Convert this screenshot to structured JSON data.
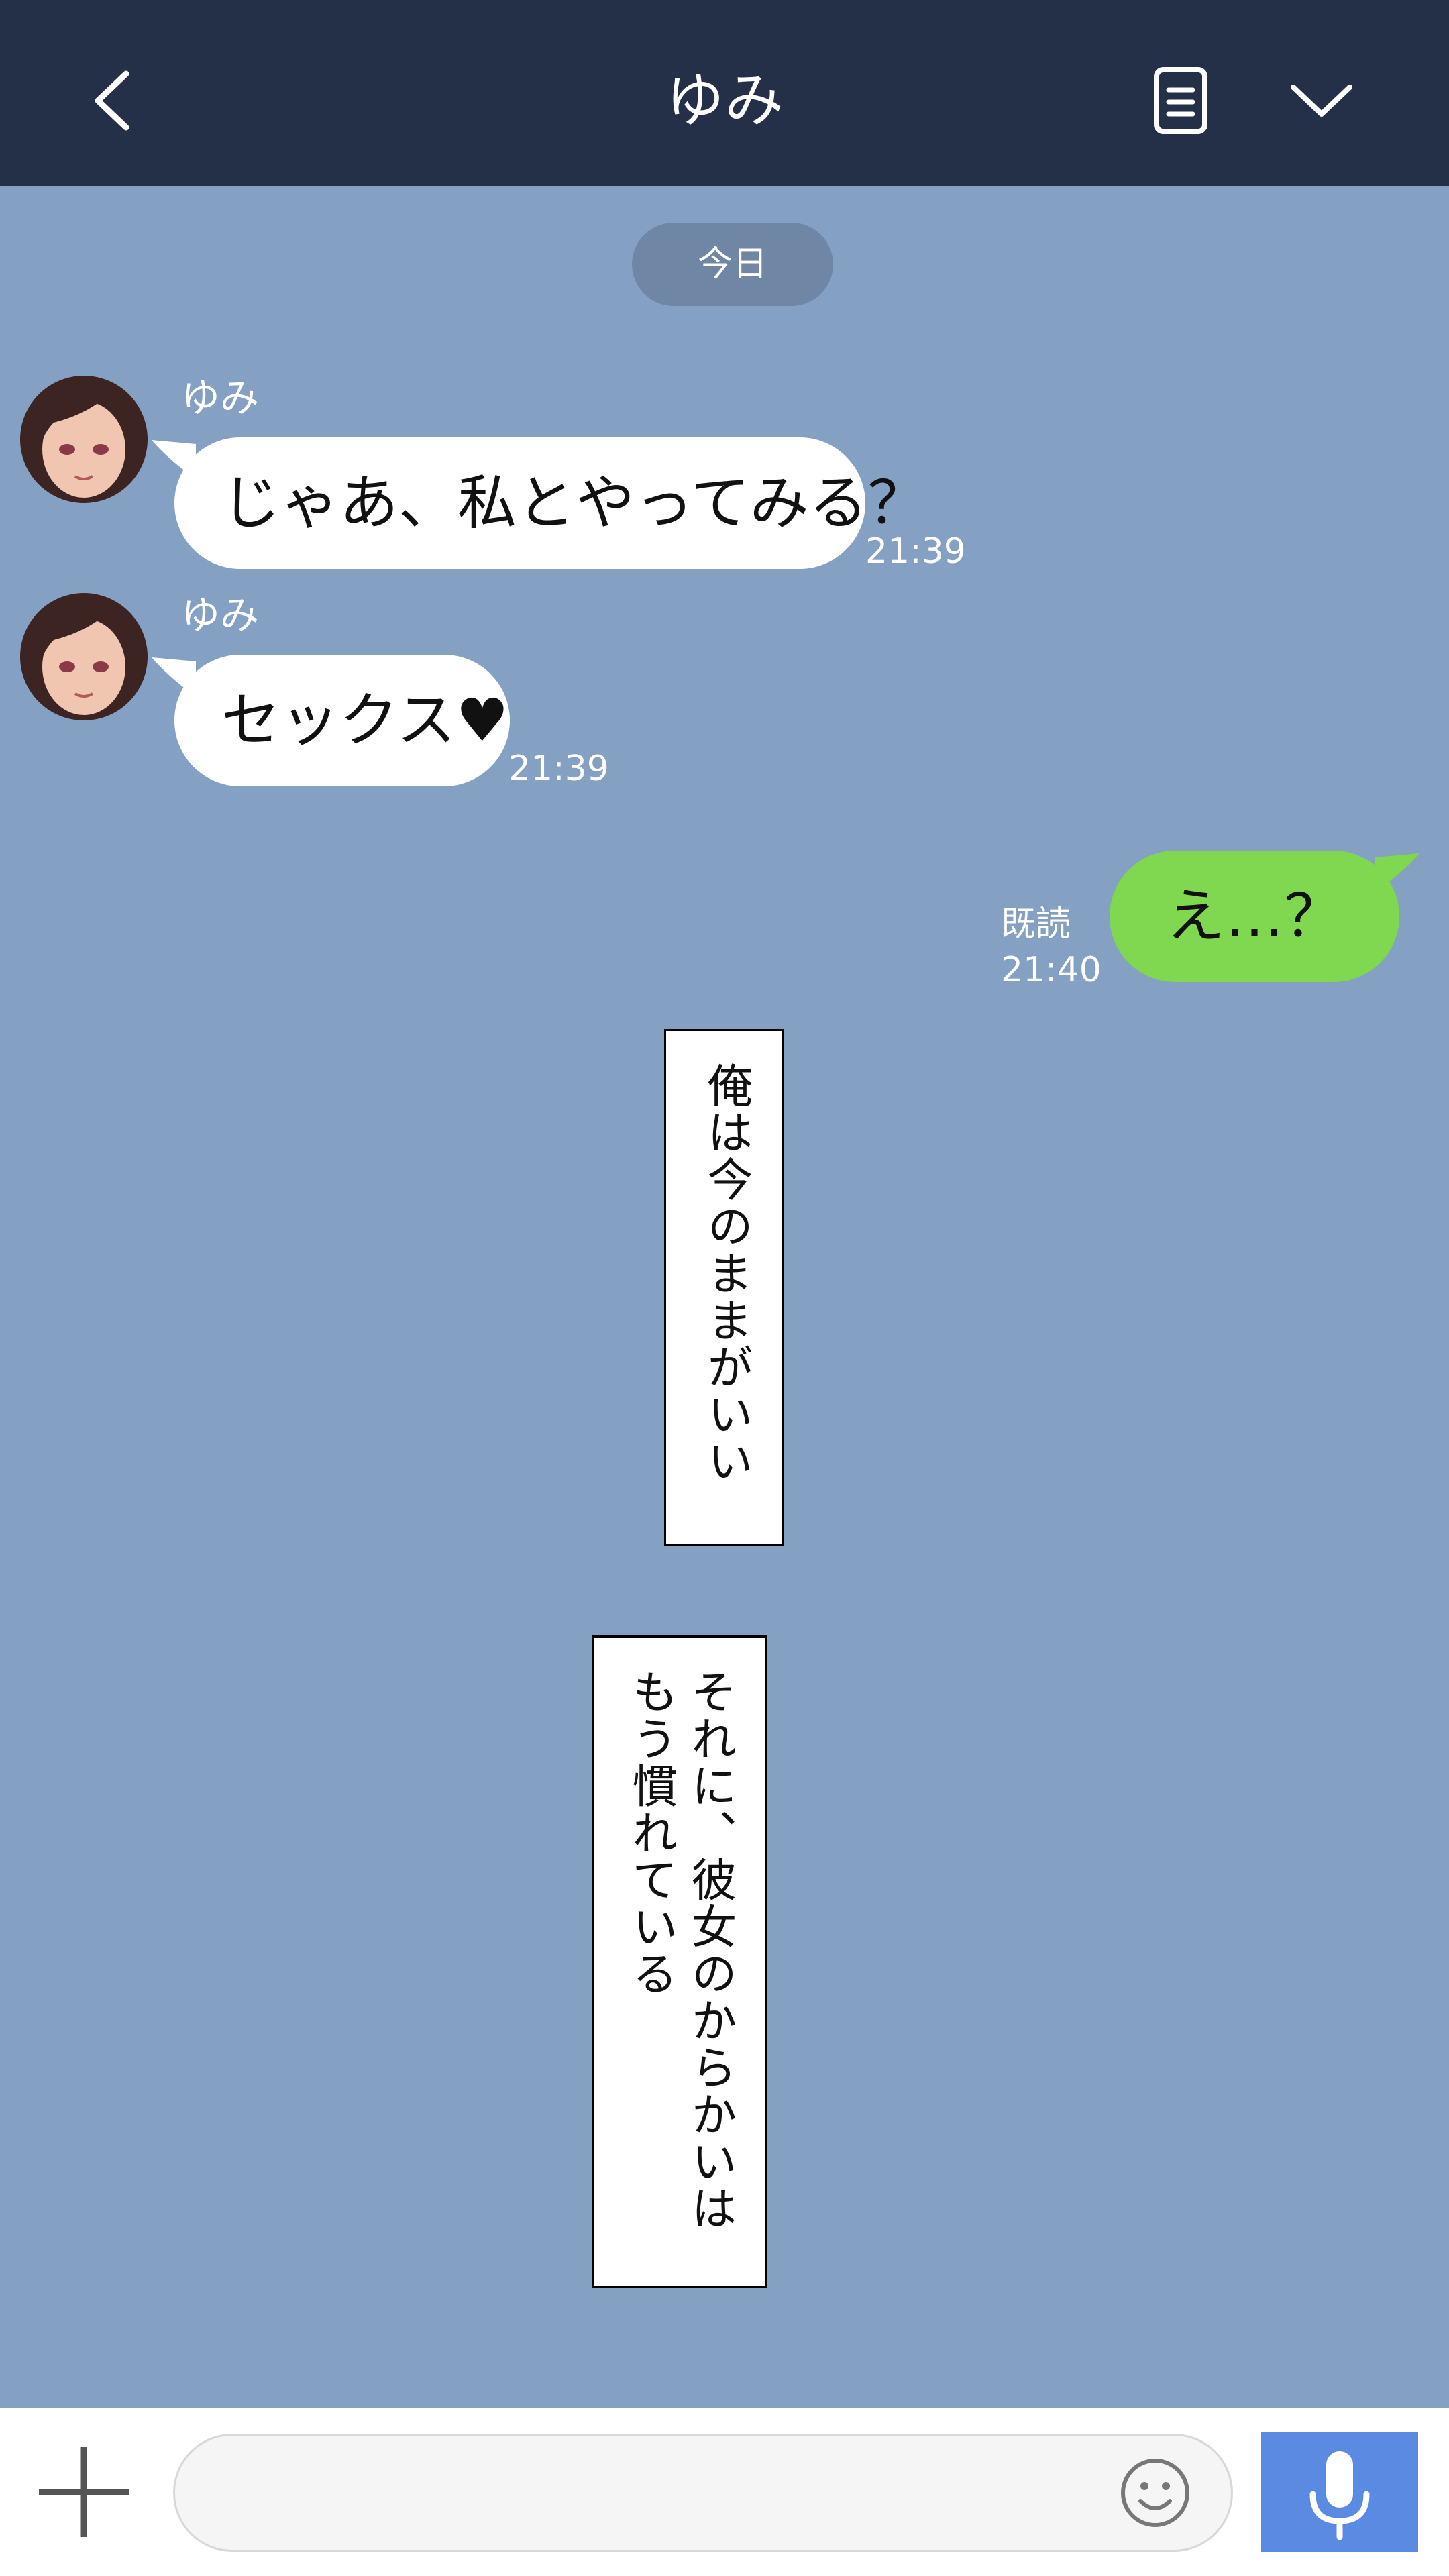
{
  "header": {
    "title": "ゆみ",
    "back_icon": "chevron-left-icon",
    "memo_icon": "note-icon",
    "menu_icon": "chevron-down-icon"
  },
  "date_separator": "今日",
  "messages": [
    {
      "sender": "ゆみ",
      "text": "じゃあ、私とやってみる？",
      "time": "21:39"
    },
    {
      "sender": "ゆみ",
      "text": "セックス♥",
      "time": "21:39"
    },
    {
      "text": "え…？",
      "read_label": "既読",
      "time": "21:40"
    }
  ],
  "narration": [
    "俺は今のままがいい",
    "それに、彼女のからかいは\nもう慣れている"
  ],
  "footer": {
    "input_value": "",
    "plus_icon": "plus-icon",
    "emoji_icon": "smiley-icon",
    "mic_icon": "microphone-icon"
  },
  "colors": {
    "header_bg": "#243048",
    "chat_bg": "#84a0c2",
    "incoming_bubble": "#ffffff",
    "outgoing_bubble": "#7fd84f",
    "mic_button": "#5b8ae2"
  }
}
